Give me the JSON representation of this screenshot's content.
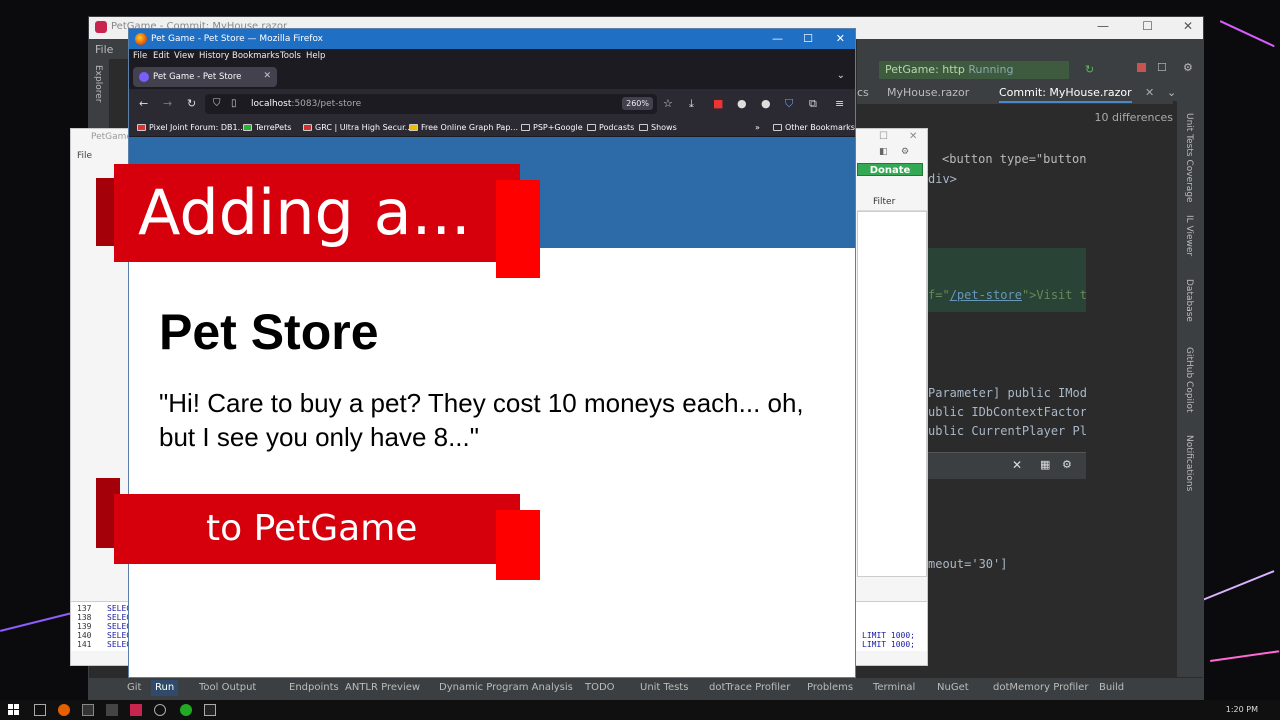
{
  "ide": {
    "title": "PetGame - Commit: MyHouse.razor",
    "menu_file": "File",
    "run_config": "PetGame: http",
    "run_status": "Running",
    "tabs": [
      "cs",
      "MyHouse.razor",
      "Commit: MyHouse.razor"
    ],
    "diff_count": "10 differences",
    "code": {
      "line1_prefix": "<button type=\"button\" @onclick=\"() =>",
      "line2": "div>",
      "line3_prefix": "f=\"",
      "line3_link": "/pet-store",
      "line3_suffix": "\">Visit the pet store</a><",
      "line4": "Parameter] public IModalService Modal",
      "line5": "ublic IDbContextFactory<PetGameDatabase",
      "line6": "ublic CurrentPlayer Player { get; set; }",
      "line7": "meout='30']"
    },
    "right_labels": [
      "Unit Tests Coverage",
      "IL Viewer",
      "Database",
      "GitHub Copilot",
      "Notifications"
    ],
    "left_label": "Explorer",
    "bottom_items": [
      "Git",
      "Run",
      "Tool Output",
      "Endpoints",
      "ANTLR Preview",
      "Dynamic Program Analysis",
      "TODO",
      "Unit Tests",
      "dotTrace Profiler",
      "Problems",
      "Terminal",
      "NuGet",
      "dotMemory Profiler",
      "Build"
    ]
  },
  "dbapp": {
    "title": "PetGame.d",
    "menu": "File",
    "donate": "Donate",
    "filter": "Filter",
    "sql_lines": [
      {
        "n": "137",
        "kw": "SELEC",
        "lim": ""
      },
      {
        "n": "138",
        "kw": "SELEC",
        "lim": "LIMIT 1000;"
      },
      {
        "n": "139",
        "kw": "SELEC",
        "lim": "LIMIT 1000;"
      },
      {
        "n": "140",
        "kw": "SELEC",
        "lim": ""
      },
      {
        "n": "141",
        "kw": "SELEC",
        "lim": ""
      }
    ]
  },
  "firefox": {
    "window_title": "Pet Game - Pet Store — Mozilla Firefox",
    "menu": [
      "File",
      "Edit",
      "View",
      "History",
      "Bookmarks",
      "Tools",
      "Help"
    ],
    "tab_title": "Pet Game - Pet Store",
    "url_host": "localhost",
    "url_rest": ":5083/pet-store",
    "zoom": "260%",
    "bookmarks": [
      "Pixel Joint Forum: DB1...",
      "TerrePets",
      "GRC | Ultra High Secur...",
      "Free Online Graph Pap...",
      "PSP+Google",
      "Podcasts",
      "Shows"
    ],
    "other_bookmarks": "Other Bookmarks"
  },
  "page": {
    "heading": "Pet Store",
    "quote": "\"Hi! Care to buy a pet? They cost 10 moneys each... oh, but I see you only have 8...\""
  },
  "overlay": {
    "top_text": "Adding a...",
    "bottom_text": "to PetGame"
  },
  "taskbar": {
    "clock": "1:20 PM"
  },
  "colors": {
    "banner_red": "#d5000b",
    "banner_dark": "#a3000a",
    "banner_bright": "#ff0000",
    "page_header": "#2c6aa8",
    "firefox_title": "#1f6fc5",
    "donate_green": "#34a853"
  }
}
